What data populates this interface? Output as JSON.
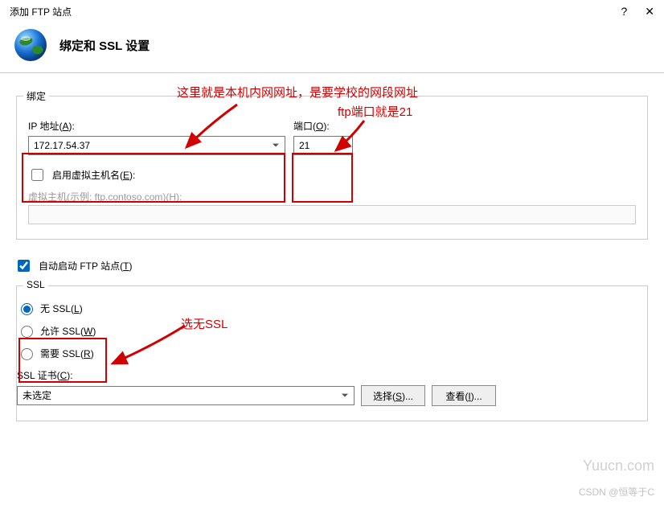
{
  "window": {
    "title": "添加 FTP 站点",
    "help": "?",
    "close": "✕"
  },
  "header": {
    "title": "绑定和 SSL 设置"
  },
  "annotations": {
    "line1": "这里就是本机内网网址，是要学校的网段网址",
    "line2": "ftp端口就是21",
    "line3": "选无SSL"
  },
  "binding": {
    "group_label": "绑定",
    "ip_label": "IP 地址(",
    "ip_label_u": "A",
    "ip_label_end": "):",
    "ip_value": "172.17.54.37",
    "port_label": "端口(",
    "port_label_u": "O",
    "port_label_end": "):",
    "port_value": "21",
    "vhost_check_label": "启用虚拟主机名(",
    "vhost_check_u": "E",
    "vhost_check_end": "):",
    "vhost_label": "虚拟主机(示例: ftp.contoso.com)(",
    "vhost_label_u": "H",
    "vhost_label_end": "):"
  },
  "auto_start": {
    "label": "自动启动 FTP 站点(",
    "u": "T",
    "end": ")"
  },
  "ssl": {
    "group_label": "SSL",
    "no_ssl": "无 SSL(",
    "no_ssl_u": "L",
    "no_ssl_end": ")",
    "allow_ssl": "允许 SSL(",
    "allow_ssl_u": "W",
    "allow_ssl_end": ")",
    "require_ssl": "需要 SSL(",
    "require_ssl_u": "R",
    "require_ssl_end": ")",
    "cert_label": "SSL 证书(",
    "cert_label_u": "C",
    "cert_label_end": "):",
    "cert_value": "未选定",
    "select_btn": "选择(",
    "select_btn_u": "S",
    "select_btn_end": ")...",
    "view_btn": "查看(",
    "view_btn_u": "I",
    "view_btn_end": ")..."
  },
  "watermark": {
    "site": "Yuucn.com",
    "credit": "CSDN @恒等于C"
  }
}
